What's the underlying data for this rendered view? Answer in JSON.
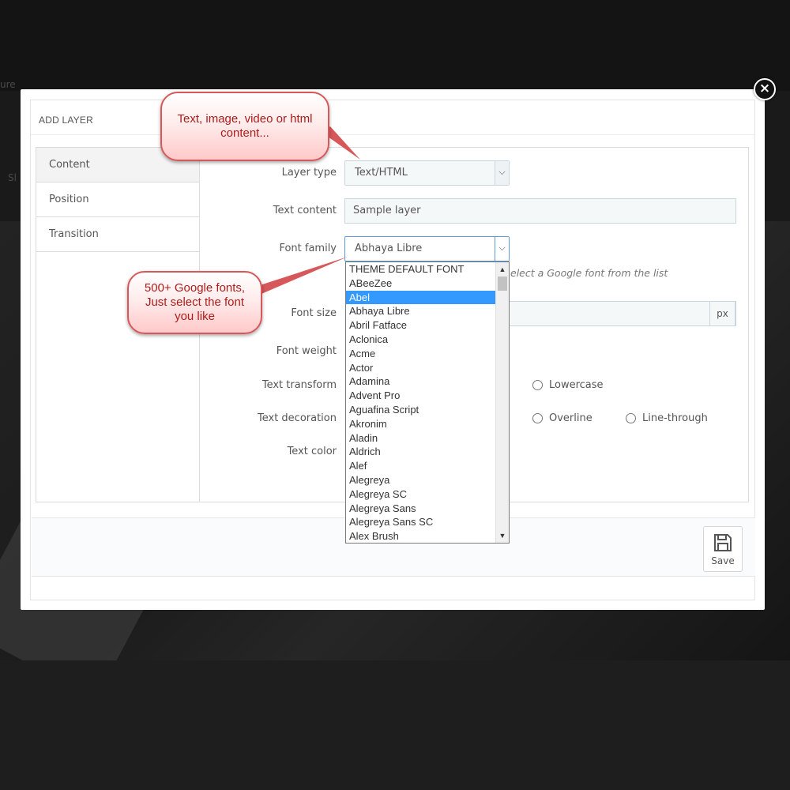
{
  "background": {
    "peek_top_left": "ure",
    "peek_left": "Sl"
  },
  "modal": {
    "close_symbol": "×",
    "title": "ADD LAYER",
    "tabs": [
      {
        "label": "Content",
        "active": true
      },
      {
        "label": "Position",
        "active": false
      },
      {
        "label": "Transition",
        "active": false
      }
    ],
    "fields": {
      "layer_type": {
        "label": "Layer type",
        "value": "Text/HTML"
      },
      "text_content": {
        "label": "Text content",
        "value": "Sample layer"
      },
      "font_family": {
        "label": "Font family",
        "value": "Abhaya Libre",
        "help": "elect a Google font from the list"
      },
      "font_size": {
        "label": "Font size",
        "unit": "px"
      },
      "font_weight": {
        "label": "Font weight"
      },
      "text_transform": {
        "label": "Text transform",
        "options": [
          "Lowercase"
        ]
      },
      "text_decoration": {
        "label": "Text decoration",
        "options": [
          "Overline",
          "Line-through"
        ]
      },
      "text_color": {
        "label": "Text color"
      }
    },
    "font_dropdown": {
      "highlighted": "Abel",
      "items": [
        "THEME DEFAULT FONT",
        "ABeeZee",
        "Abel",
        "Abhaya Libre",
        "Abril Fatface",
        "Aclonica",
        "Acme",
        "Actor",
        "Adamina",
        "Advent Pro",
        "Aguafina Script",
        "Akronim",
        "Aladin",
        "Aldrich",
        "Alef",
        "Alegreya",
        "Alegreya SC",
        "Alegreya Sans",
        "Alegreya Sans SC",
        "Alex Brush"
      ]
    },
    "footer": {
      "save_label": "Save"
    }
  },
  "annotations": {
    "layer_type_note": [
      "Text, image, video or html",
      "content..."
    ],
    "font_note": [
      "500+ Google fonts,",
      "Just select the font",
      "you like"
    ]
  },
  "colors": {
    "bubble_border": "#d6585a",
    "bubble_text": "#b01b1b",
    "selected_item": "#3399ff"
  }
}
